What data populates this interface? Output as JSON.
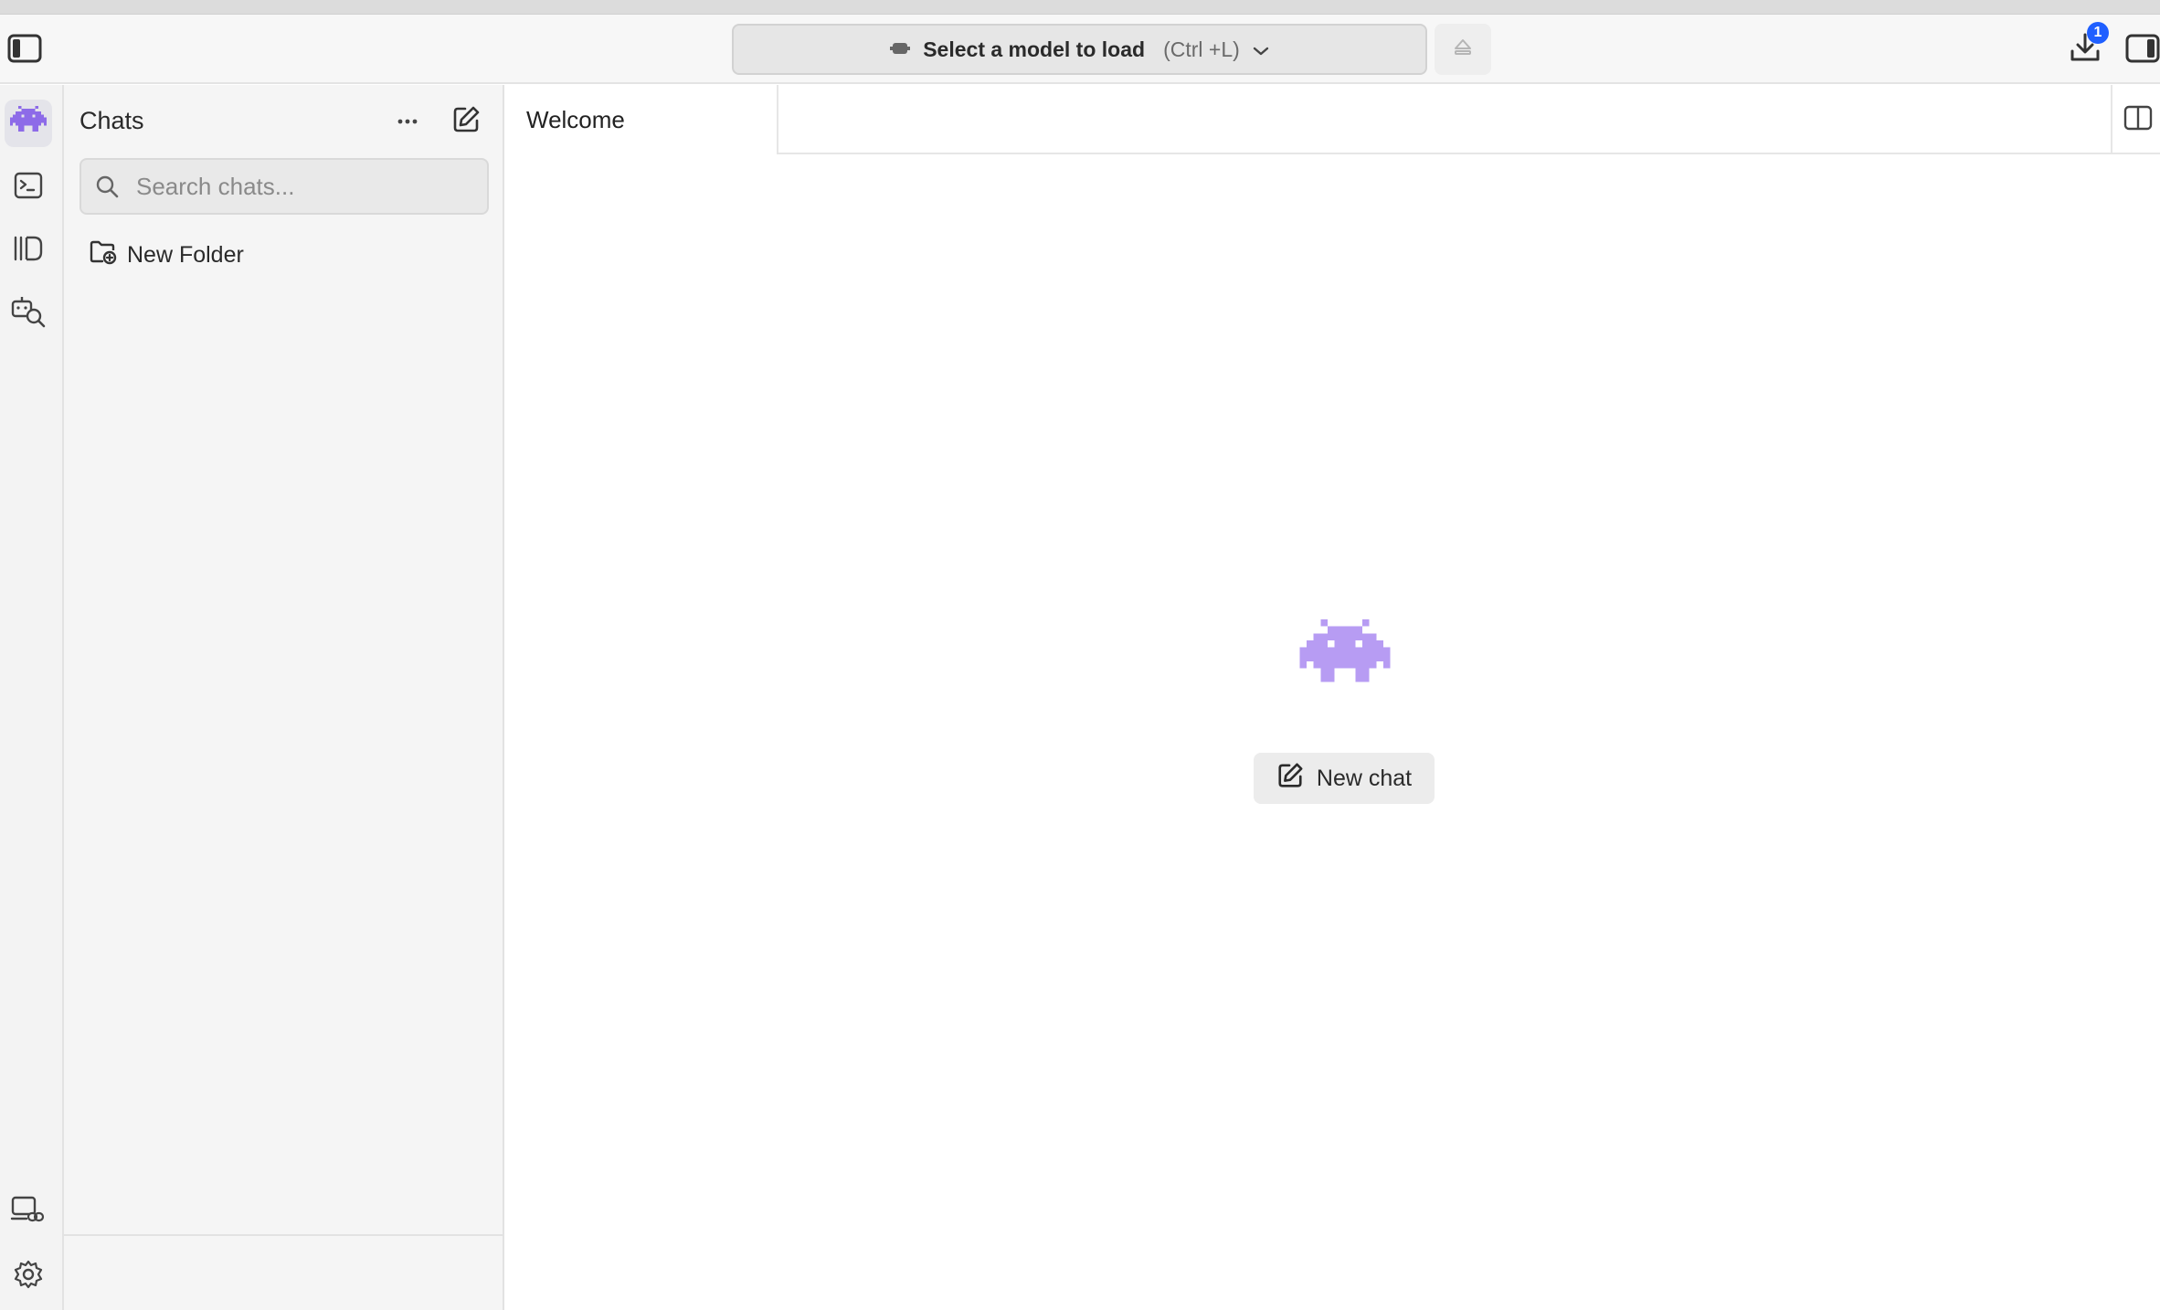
{
  "header": {
    "model_select_label": "Select a model to load",
    "model_select_shortcut": "(Ctrl +L)",
    "downloads_badge": "1"
  },
  "chats": {
    "title": "Chats",
    "search_placeholder": "Search chats...",
    "new_folder_label": "New Folder"
  },
  "main": {
    "tabs": [
      {
        "label": "Welcome"
      }
    ],
    "new_chat_label": "New chat"
  },
  "colors": {
    "accent_purple": "#a98bf2",
    "badge_blue": "#1f5fff"
  },
  "icons": {
    "sidebar_toggle": "sidebar-left-icon",
    "rail": [
      "robot-icon",
      "terminal-icon",
      "library-icon",
      "model-search-icon",
      "link-device-icon",
      "gear-icon"
    ],
    "right_panel": "sidebar-right-icon"
  }
}
